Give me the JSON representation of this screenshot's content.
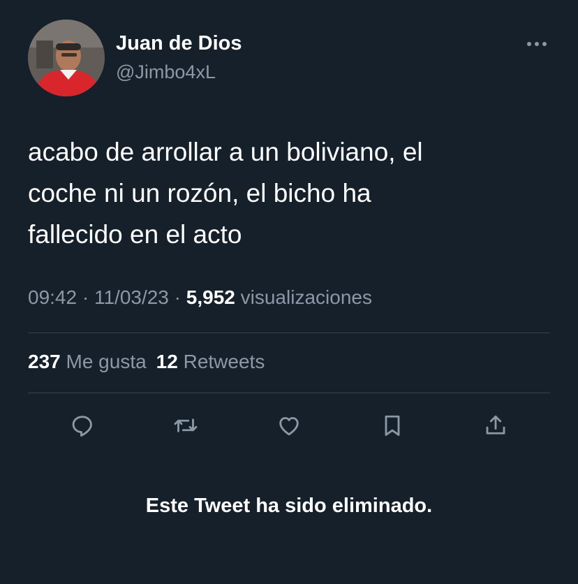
{
  "theme": {
    "background": "#15202b",
    "text_primary": "#ffffff",
    "text_secondary": "#8b98a5",
    "divider": "#38444d"
  },
  "author": {
    "display_name": "Juan de Dios",
    "handle": "@Jimbo4xL",
    "avatar_icon": "profile-photo"
  },
  "more_icon": "more-horizontal-icon",
  "tweet": {
    "lines": [
      "acabo de arrollar a un boliviano, el",
      "coche ni un rozón, el bicho ha",
      "fallecido en el acto"
    ]
  },
  "meta": {
    "time": "09:42",
    "separator": "·",
    "date": "11/03/23",
    "views_count": "5,952",
    "views_label": "visualizaciones"
  },
  "stats": {
    "likes_count": "237",
    "likes_label": "Me gusta",
    "retweets_count": "12",
    "retweets_label": "Retweets"
  },
  "actions": [
    {
      "icon": "reply-icon"
    },
    {
      "icon": "retweet-icon"
    },
    {
      "icon": "like-heart-icon"
    },
    {
      "icon": "bookmark-icon"
    },
    {
      "icon": "share-icon"
    }
  ],
  "notice": {
    "deleted_text": "Este Tweet ha sido eliminado."
  }
}
